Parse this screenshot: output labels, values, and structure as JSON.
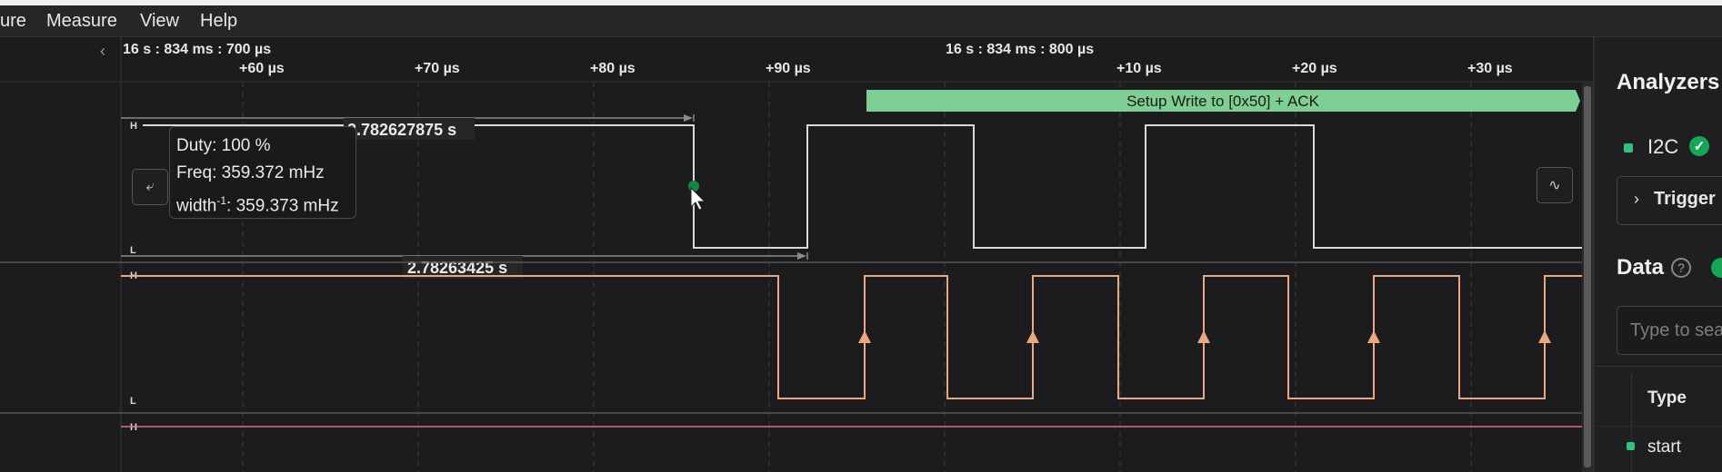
{
  "menu": [
    "ure",
    "Measure",
    "View",
    "Help"
  ],
  "timeline": {
    "left_ref": "16 s : 834 ms : 700 µs",
    "right_ref": "16 s : 834 ms : 800 µs",
    "ticks": [
      "+60 µs",
      "+70 µs",
      "+80 µs",
      "+90 µs",
      "+10 µs",
      "+20 µs",
      "+30 µs"
    ]
  },
  "decoder": {
    "label": "Setup Write to [0x50] + ACK",
    "color": "#7ecf93"
  },
  "measurements": {
    "high_width": "2.782627875 s",
    "low_width": "2.78263425 s"
  },
  "tooltip": {
    "duty": "Duty: 100 %",
    "freq": "Freq: 359.372 mHz",
    "width_prefix": "width",
    "width_sup": "-1",
    "width_value": ": 359.373 mHz"
  },
  "channels": [
    {
      "high": "H",
      "low": "L",
      "color": "#d9d9d9"
    },
    {
      "high": "H",
      "low": "L",
      "color": "#e8a882"
    },
    {
      "high": "H",
      "color": "#e0707a"
    }
  ],
  "nav": {
    "prev_icon": "⤶",
    "next_icon": "∿"
  },
  "panel": {
    "analyzers_title": "Analyzers",
    "analyzer_name": "I2C",
    "analyzer_check": "✓",
    "trigger_label": "Trigger",
    "trigger_chevron": "›",
    "data_title": "Data",
    "help_glyph": "?",
    "search_placeholder": "Type to search",
    "column_type": "Type",
    "rows": [
      {
        "type": "start"
      }
    ]
  },
  "colors": {
    "accent_green": "#2ec27e",
    "background": "#1c1c1e"
  }
}
